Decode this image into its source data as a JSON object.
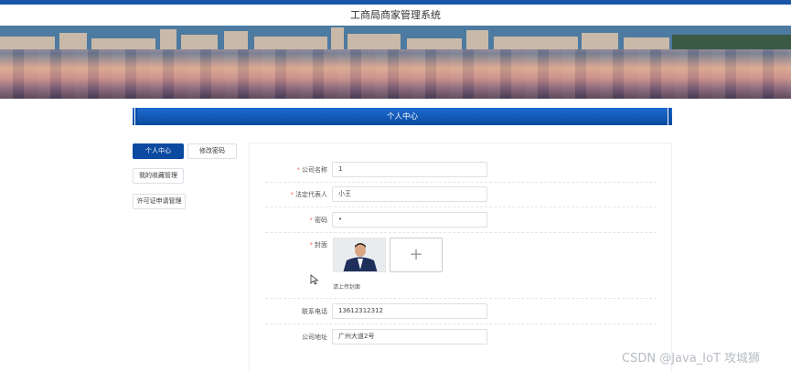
{
  "header": {
    "title": "工商局商家管理系统"
  },
  "banner": {
    "carousel_active_index": 0,
    "carousel_count": 2
  },
  "section": {
    "title": "个人中心"
  },
  "sidebar": {
    "items": [
      {
        "label": "个人中心"
      },
      {
        "label": "修改密码"
      },
      {
        "label": "我的收藏管理"
      },
      {
        "label": "许可证申请管理"
      }
    ]
  },
  "form": {
    "company_name": {
      "label": "公司名称",
      "value": "1"
    },
    "legal_rep": {
      "label": "法定代表人",
      "value": "小王"
    },
    "password": {
      "label": "密码",
      "value": "•"
    },
    "cover": {
      "label": "封面",
      "hint": "请上传封面",
      "upload_symbol": "+"
    },
    "phone": {
      "label": "联系电话",
      "value": "13612312312"
    },
    "address": {
      "label": "公司地址",
      "value": "广州大道2号"
    }
  },
  "watermark": {
    "text": "CSDN @Java_IoT 攻城狮"
  },
  "colors": {
    "primary": "#0b4aa0",
    "required": "#f56c6c"
  }
}
